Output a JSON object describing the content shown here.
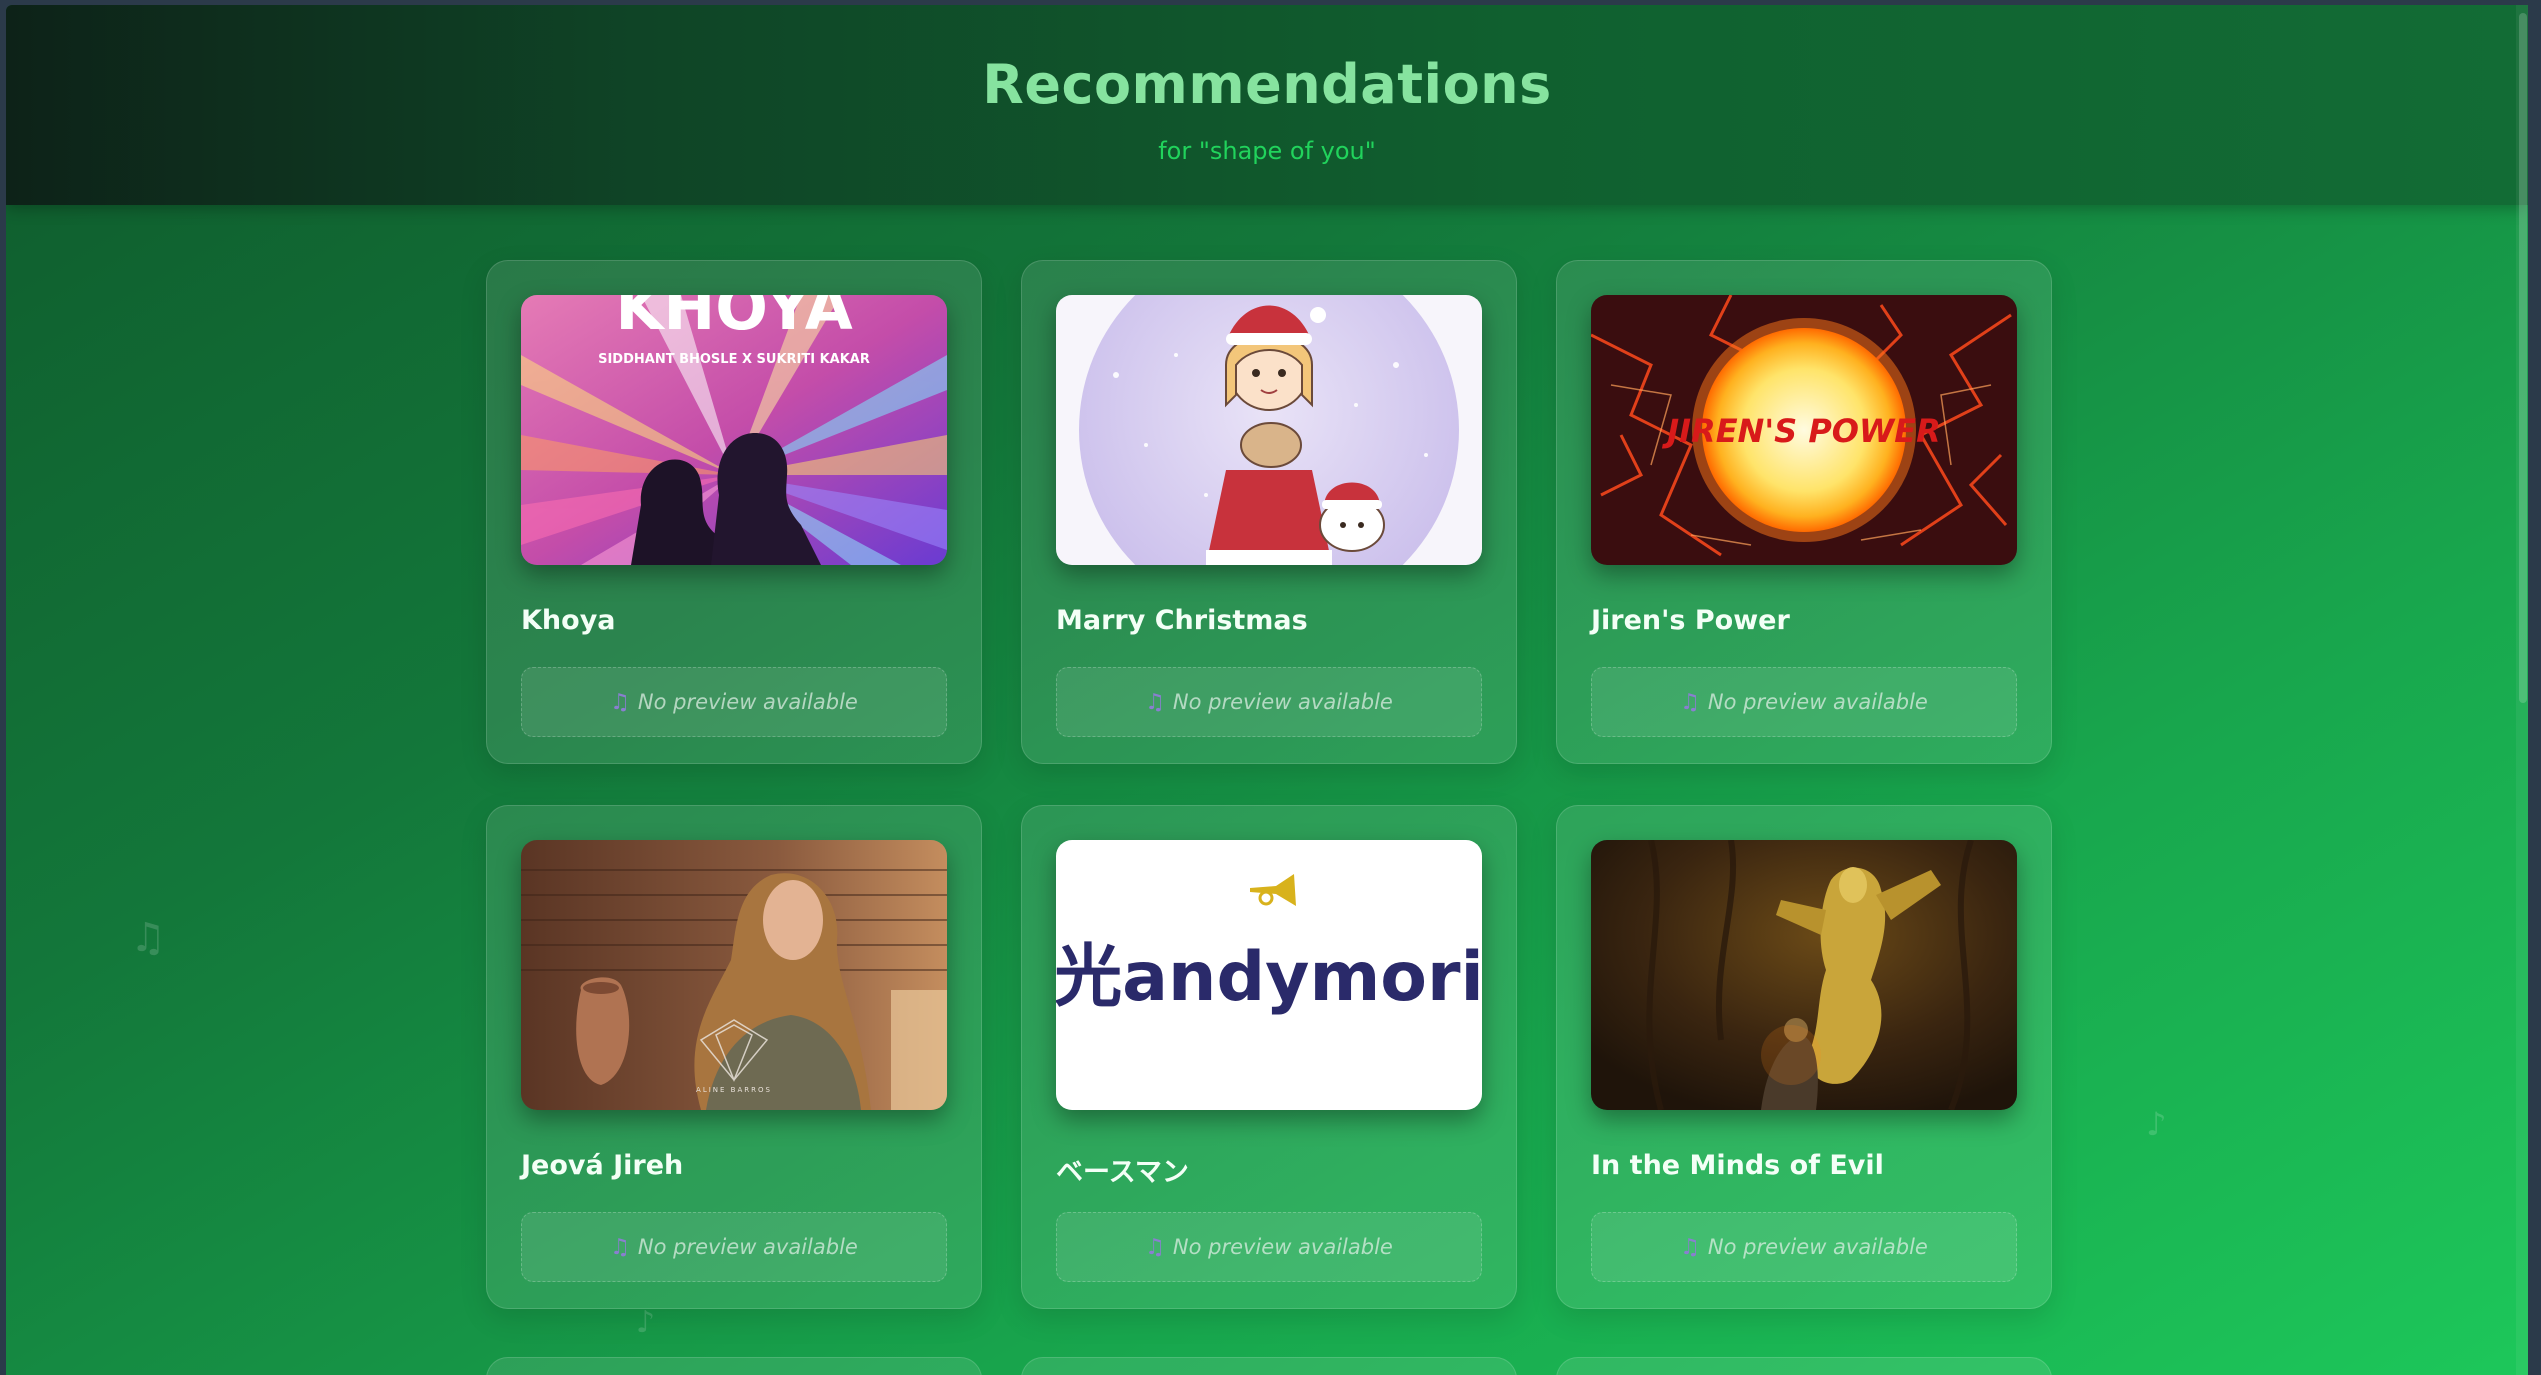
{
  "header": {
    "title": "Recommendations",
    "subtitle": "for \"shape of you\""
  },
  "cards": [
    {
      "title": "Khoya",
      "preview_text": "No preview available",
      "art": {
        "headline": "KHOYA",
        "credits": "SIDDHANT BHOSLE X SUKRITI KAKAR"
      }
    },
    {
      "title": "Marry Christmas",
      "preview_text": "No preview available"
    },
    {
      "title": "Jiren's Power",
      "preview_text": "No preview available",
      "art": {
        "headline": "JIREN'S POWER"
      }
    },
    {
      "title": "Jeová Jireh",
      "preview_text": "No preview available",
      "art": {
        "logo_text": "ALINE BARROS"
      }
    },
    {
      "title": "ベースマン",
      "preview_text": "No preview available",
      "art": {
        "logo_text": "光andymori"
      }
    },
    {
      "title": "In the Minds of Evil",
      "preview_text": "No preview available"
    }
  ],
  "icons": {
    "preview": "music-note-icon"
  },
  "colors": {
    "title": "#86e39f",
    "subtitle": "#21d35c",
    "background_start": "#0f5a2c",
    "background_end": "#1dc75a"
  }
}
